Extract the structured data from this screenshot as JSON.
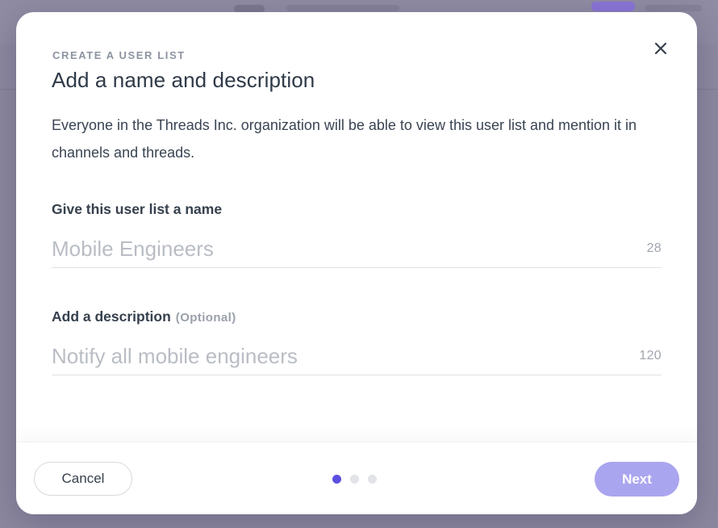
{
  "modal": {
    "eyebrow": "CREATE A USER LIST",
    "title": "Add a name and description",
    "description": "Everyone in the Threads Inc. organization will be able to view this user list and mention it in channels and threads.",
    "close_icon": "close-icon"
  },
  "form": {
    "name": {
      "label": "Give this user list a name",
      "placeholder": "Mobile Engineers",
      "value": "",
      "remaining": "28"
    },
    "description": {
      "label": "Add a description",
      "optional_label": "(Optional)",
      "placeholder": "Notify all mobile engineers",
      "value": "",
      "remaining": "120"
    }
  },
  "footer": {
    "cancel_label": "Cancel",
    "next_label": "Next",
    "steps_total": 3,
    "current_step": 1
  },
  "colors": {
    "accent": "#5b4fe0",
    "next_button_disabled": "#aaa5ef",
    "overlay": "#8b889f"
  }
}
